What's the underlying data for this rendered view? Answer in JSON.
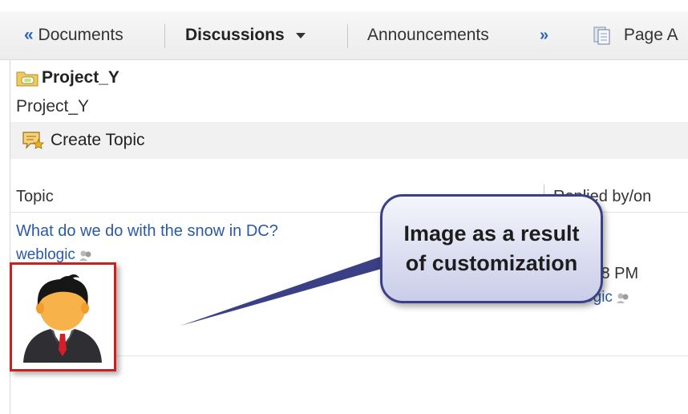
{
  "tabs": {
    "documents_label": "Documents",
    "discussions_label": "Discussions",
    "announcements_label": "Announcements",
    "more_label": "»",
    "page_label": "Page A",
    "back_arrow": "«"
  },
  "header": {
    "title": "Project_Y",
    "subtitle": "Project_Y"
  },
  "toolbar": {
    "create_topic_label": "Create Topic"
  },
  "table": {
    "columns": [
      "Topic",
      "Replied by/on"
    ],
    "rows": [
      {
        "topic": "What do we do with the snow in DC?",
        "author": "weblogic",
        "replied_time": "0 2:58 PM",
        "replied_by": "weblogic"
      }
    ]
  },
  "callout": {
    "text": "Image as a result of customization"
  },
  "colors": {
    "link": "#2b5aa5",
    "highlight_border": "#cc1f1f",
    "callout_border": "#3a3f86"
  }
}
